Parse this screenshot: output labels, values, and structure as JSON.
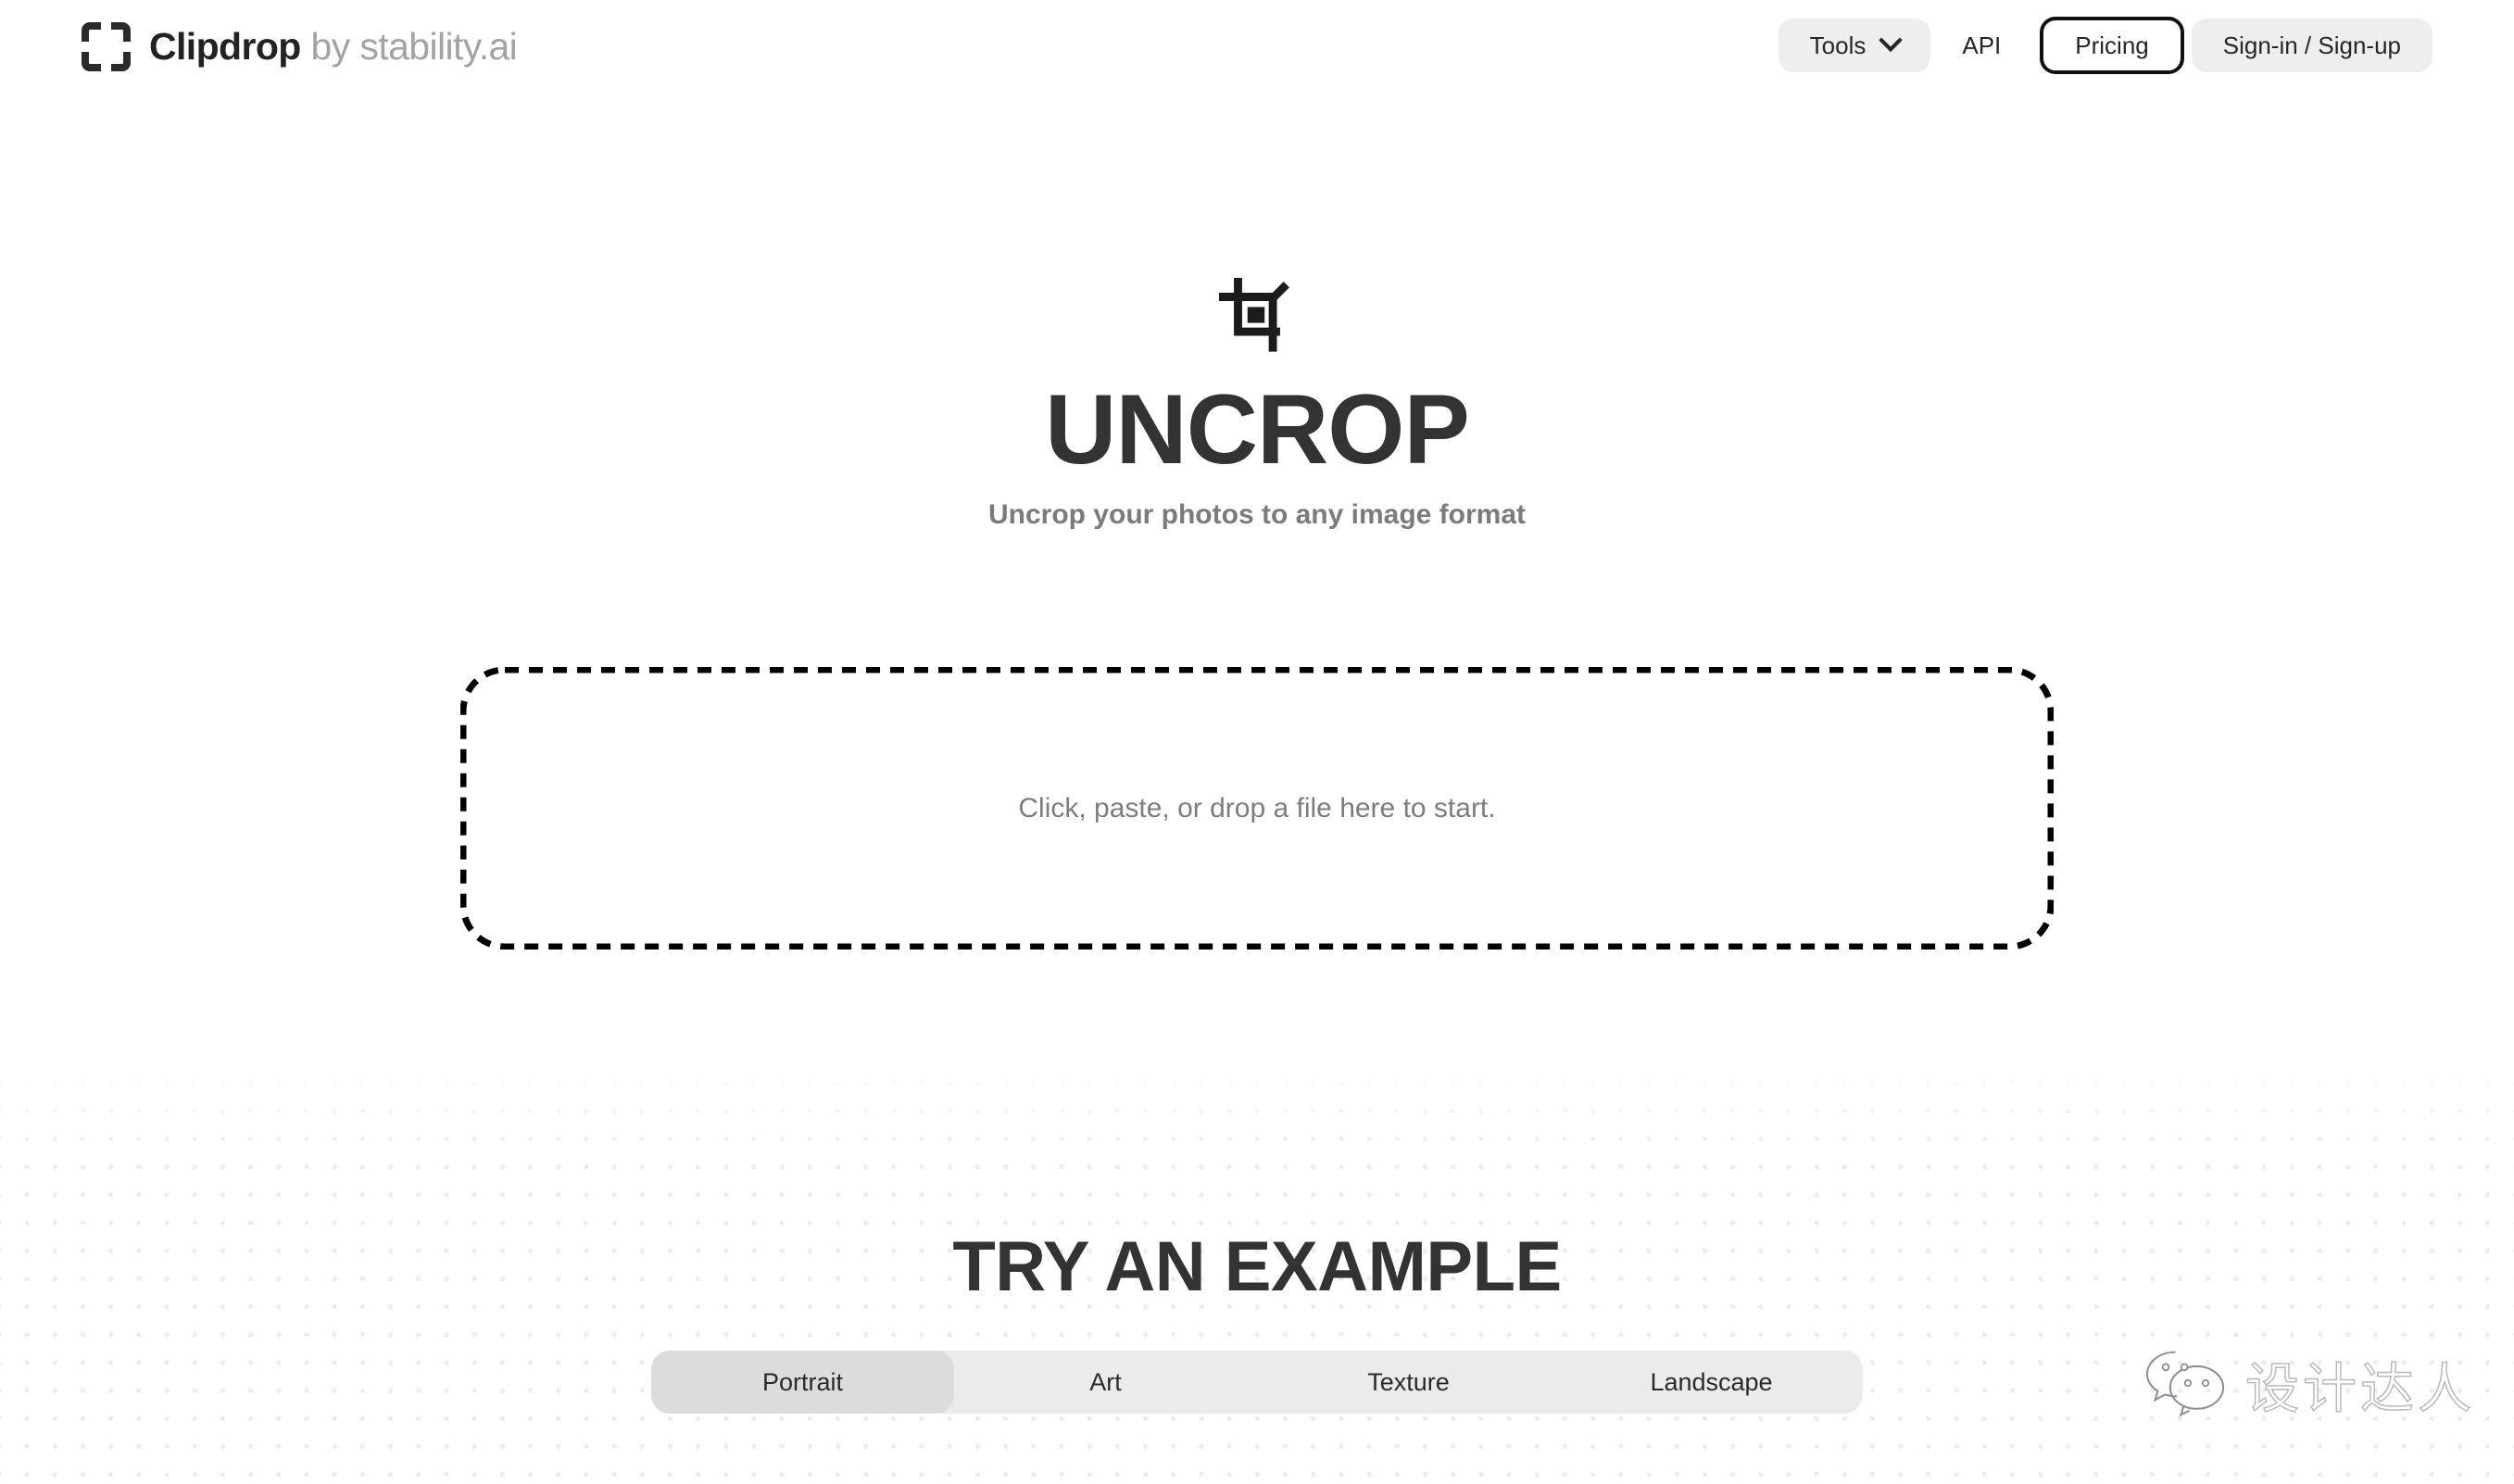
{
  "header": {
    "brand": {
      "icon": "clipdrop-frame-icon",
      "name": "Clipdrop",
      "by": " by stability.ai"
    },
    "nav": {
      "tools_label": "Tools",
      "tools_chevron": "chevron-down-icon",
      "api_label": "API",
      "pricing_label": "Pricing",
      "account_label": "Sign-in / Sign-up"
    }
  },
  "hero": {
    "icon": "crop-icon",
    "title": "UNCROP",
    "subtitle": "Uncrop your photos to any image format"
  },
  "dropzone": {
    "label": "Click, paste, or drop a file here to start."
  },
  "example": {
    "title": "TRY AN EXAMPLE",
    "tabs": [
      {
        "label": "Portrait",
        "active": true
      },
      {
        "label": "Art",
        "active": false
      },
      {
        "label": "Texture",
        "active": false
      },
      {
        "label": "Landscape",
        "active": false
      }
    ]
  },
  "watermark": {
    "icon": "wechat-icon",
    "text": "设计达人"
  },
  "colors": {
    "page_bg": "#ffffff",
    "text_primary": "#333333",
    "text_muted": "#7b7b7b",
    "pill_bg": "#eeeeee",
    "outline": "#111111",
    "tabbar_bg": "#ebebeb",
    "tab_active_bg": "#dcdcdc",
    "dot_pattern": "#eceded"
  }
}
